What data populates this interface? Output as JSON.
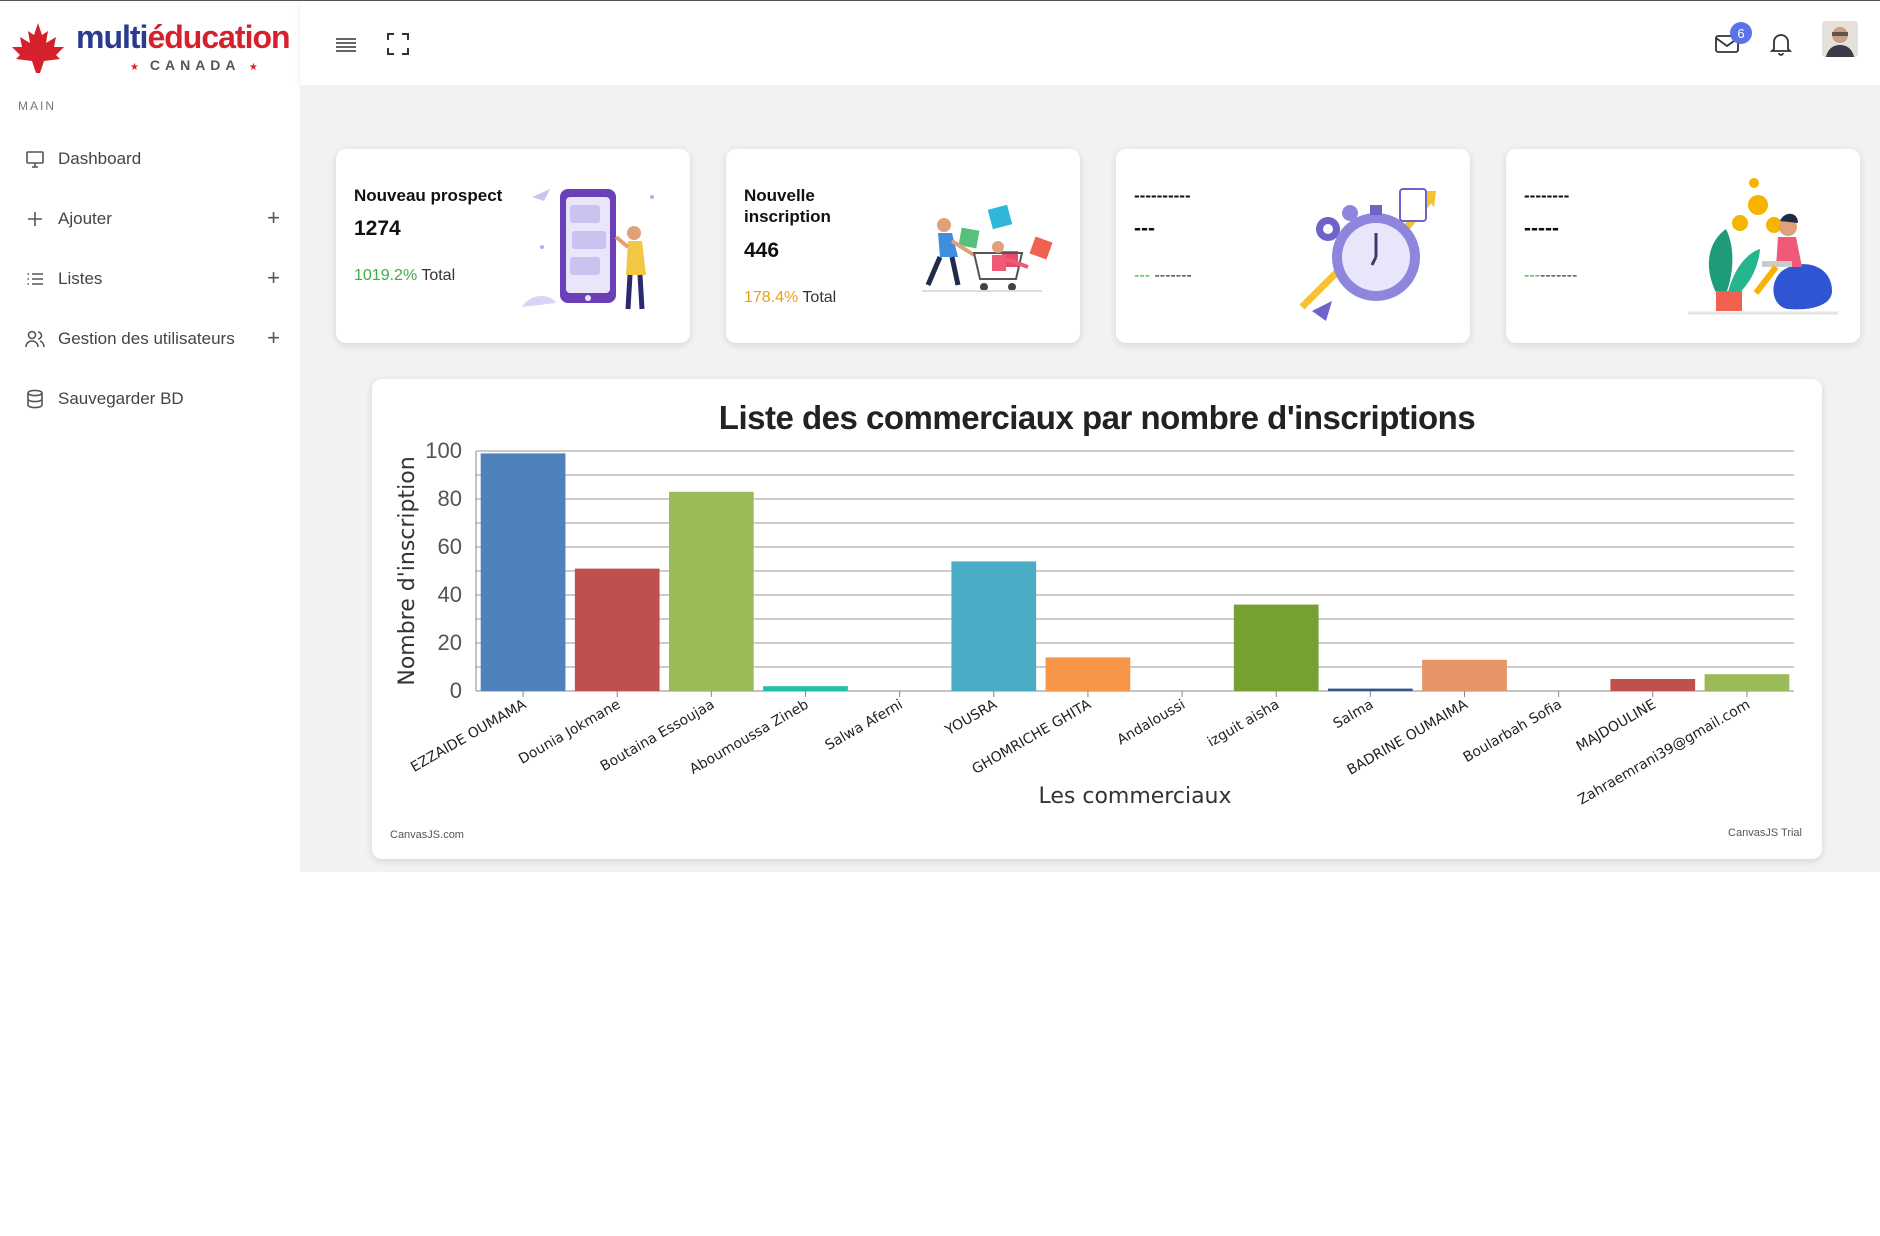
{
  "brand": {
    "name_part1": "multi",
    "name_part2": "éducation",
    "subtitle": "CANADA",
    "star": "★"
  },
  "sidebar": {
    "section_label": "MAIN",
    "items": [
      {
        "label": "Dashboard",
        "icon": "monitor-icon",
        "expandable": false
      },
      {
        "label": "Ajouter",
        "icon": "plus-icon",
        "expandable": true
      },
      {
        "label": "Listes",
        "icon": "list-icon",
        "expandable": true
      },
      {
        "label": "Gestion des utilisateurs",
        "icon": "users-icon",
        "expandable": true
      },
      {
        "label": "Sauvegarder BD",
        "icon": "database-icon",
        "expandable": false
      }
    ],
    "expand_symbol": "+"
  },
  "header": {
    "menu_icon": "hamburger-icon",
    "fullscreen_icon": "fullscreen-icon",
    "mail_icon": "mail-icon",
    "mail_count": "6",
    "bell_icon": "bell-icon"
  },
  "cards": [
    {
      "title": "Nouveau prospect",
      "value": "1274",
      "percent": "1019.2%",
      "percent_color": "#3cb043",
      "suffix": "Total"
    },
    {
      "title": "Nouvelle inscription",
      "value": "446",
      "percent": "178.4%",
      "percent_color": "#f39c12",
      "suffix": "Total"
    },
    {
      "title": "----------",
      "value": "---",
      "percent": "---",
      "percent_color": "#3cb043",
      "suffix": "-------"
    },
    {
      "title": "--------",
      "value": "-----",
      "percent": "---",
      "percent_color": "#3cb043",
      "suffix": "-------"
    }
  ],
  "chart_footer": {
    "left": "CanvasJS.com",
    "right": "CanvasJS Trial"
  },
  "chart_data": {
    "type": "bar",
    "title": "Liste des commerciaux par nombre d'inscriptions",
    "xlabel": "Les commerciaux",
    "ylabel": "Nombre d'inscription",
    "ylim": [
      0,
      100
    ],
    "yticks": [
      0,
      20,
      40,
      60,
      80,
      100
    ],
    "grid": true,
    "categories": [
      "EZZAIDE OUMAMA",
      "Dounia Jokmane",
      "Boutaina Essoujaa",
      "Aboumoussa Zineb",
      "Salwa Aferni",
      "YOUSRA",
      "GHOMRICHE GHITA",
      "Andaloussi",
      "izguit aisha",
      "Salma",
      "BADRINE OUMAIMA",
      "Boularbah Sofia",
      "MAJDOULINE",
      "Zahraemrani39@gmail.com"
    ],
    "values": [
      99,
      51,
      83,
      2,
      0,
      54,
      14,
      0,
      36,
      1,
      13,
      0,
      5,
      7
    ],
    "colors": [
      "#4f81bc",
      "#c0504e",
      "#9bbb58",
      "#23bfaa",
      "#8064a1",
      "#4aacc5",
      "#f79647",
      "#33558b",
      "#77a033",
      "#33558b",
      "#e59566",
      "#9bbb58",
      "#c0504e",
      "#9bbb58"
    ]
  }
}
